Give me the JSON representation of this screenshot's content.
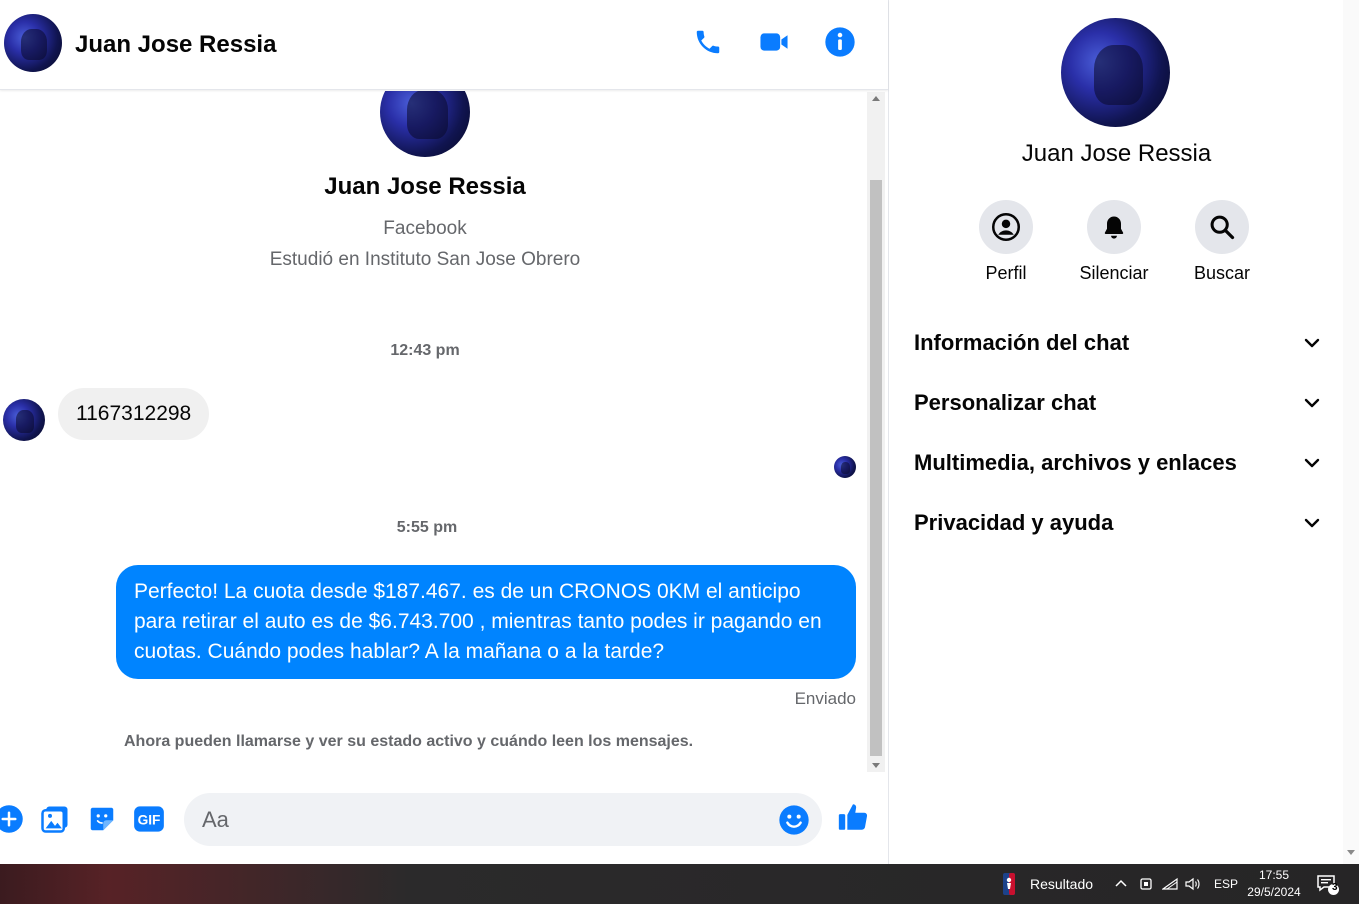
{
  "header": {
    "contact_name": "Juan Jose Ressia"
  },
  "profile": {
    "name": "Juan Jose Ressia",
    "source": "Facebook",
    "education": "Estudió en Instituto San Jose Obrero"
  },
  "messages": [
    {
      "timestamp": "12:43 pm",
      "direction": "incoming",
      "text": "1167312298"
    },
    {
      "timestamp": "5:55 pm",
      "direction": "outgoing",
      "text": "Perfecto! La cuota desde $187.467. es de un CRONOS 0KM el anticipo para retirar el auto es de $6.743.700 , mientras tanto podes ir pagando en cuotas. Cuándo podes hablar? A la mañana o a la tarde?"
    }
  ],
  "sent_status": "Enviado",
  "notice": "Ahora pueden llamarse y ver su estado activo y cuándo leen los mensajes.",
  "composer": {
    "placeholder": "Aa",
    "value": ""
  },
  "info_panel": {
    "name": "Juan Jose Ressia",
    "actions": [
      {
        "label": "Perfil",
        "icon": "profile-icon"
      },
      {
        "label": "Silenciar",
        "icon": "bell-icon"
      },
      {
        "label": "Buscar",
        "icon": "search-icon"
      }
    ],
    "sections": [
      {
        "label": "Información del chat"
      },
      {
        "label": "Personalizar chat"
      },
      {
        "label": "Multimedia, archivos y enlaces"
      },
      {
        "label": "Privacidad y ayuda"
      }
    ]
  },
  "taskbar": {
    "widget_label": "Resultado",
    "language": "ESP",
    "time": "17:55",
    "date": "29/5/2024",
    "notification_count": "3"
  },
  "colors": {
    "accent": "#0084ff",
    "icon_blue": "#0a7cff",
    "incoming_bubble": "#f0f0f0",
    "secondary_text": "#65676b"
  }
}
